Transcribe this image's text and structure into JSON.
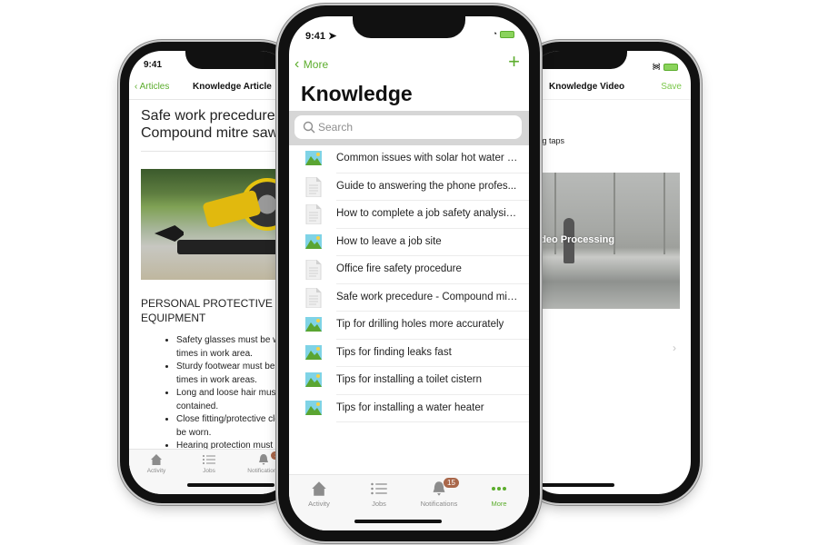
{
  "left_phone": {
    "status_time": "9:41",
    "nav": {
      "back_label": "Articles",
      "title": "Knowledge Article"
    },
    "article": {
      "title_line1": "Safe work precedure -",
      "title_line2": "Compound mitre saw",
      "section_heading_line1": "PERSONAL PROTECTIVE",
      "section_heading_line2": "EQUIPMENT",
      "bullets": [
        "Safety glasses must be worn at all",
        "times in work area.",
        "Sturdy footwear must be worn at all",
        "times in work areas.",
        "Long and loose hair must be",
        "contained.",
        "Close fitting/protective clothing must",
        "be worn.",
        "Hearing protection must be"
      ]
    },
    "tabbar": [
      {
        "label": "Activity",
        "icon": "house-icon"
      },
      {
        "label": "Jobs",
        "icon": "list-icon"
      },
      {
        "label": "Notifications",
        "icon": "bell-icon",
        "badge": "15"
      }
    ]
  },
  "center_phone": {
    "status_time": "9:41",
    "nav": {
      "back_label": "More",
      "add_label": "+"
    },
    "title": "Knowledge",
    "search": {
      "placeholder": "Search",
      "value": ""
    },
    "items": [
      {
        "label": "Common issues with solar hot water s...",
        "icon": "image-icon"
      },
      {
        "label": "Guide to answering the phone profes...",
        "icon": "document-icon"
      },
      {
        "label": "How to complete a job safety analysis...",
        "icon": "document-icon"
      },
      {
        "label": "How to leave a job site",
        "icon": "image-icon"
      },
      {
        "label": "Office fire safety procedure",
        "icon": "document-icon"
      },
      {
        "label": "Safe work precedure - Compound mit...",
        "icon": "document-icon"
      },
      {
        "label": "Tip for drilling holes more accurately",
        "icon": "image-icon"
      },
      {
        "label": "Tips for finding leaks fast",
        "icon": "image-icon"
      },
      {
        "label": "Tips for installing a toilet cistern",
        "icon": "image-icon"
      },
      {
        "label": "Tips for installing a water heater",
        "icon": "image-icon"
      }
    ],
    "tabbar": [
      {
        "label": "Activity",
        "icon": "house-icon"
      },
      {
        "label": "Jobs",
        "icon": "list-icon"
      },
      {
        "label": "Notifications",
        "icon": "bell-icon",
        "badge": "15"
      },
      {
        "label": "More",
        "icon": "more-icon",
        "active": true
      }
    ]
  },
  "right_phone": {
    "nav": {
      "title": "Knowledge Video",
      "save_label": "Save"
    },
    "description": "acing taps",
    "video_label": "Video Processing"
  },
  "colors": {
    "accent": "#5cad2d",
    "badge": "#a9674a"
  }
}
